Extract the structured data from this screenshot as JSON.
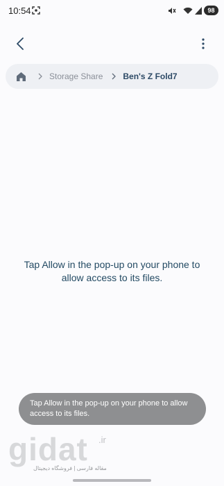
{
  "status_bar": {
    "time": "10:54",
    "battery": "98",
    "icons": [
      "screenshot-icon",
      "mute-icon",
      "wifi-icon",
      "signal-icon"
    ]
  },
  "app_bar": {
    "back_icon": "chevron-left-icon",
    "more_icon": "more-vertical-icon"
  },
  "breadcrumb": {
    "home_icon": "home-icon",
    "items": [
      "Storage Share",
      "Ben's Z Fold7"
    ]
  },
  "main": {
    "message": "Tap Allow in the pop-up on your phone to allow access to its files."
  },
  "toast": {
    "text": "Tap Allow in the pop-up on your phone to allow access to its files."
  },
  "watermark": {
    "word": "gidat",
    "tld": ".ir",
    "subtitle": "مقاله فارسی | فروشگاه دیجیتال"
  },
  "colors": {
    "accent_text": "#234a63",
    "breadcrumb_bg": "#eef0f4",
    "toast_bg": "#8e8f91"
  }
}
